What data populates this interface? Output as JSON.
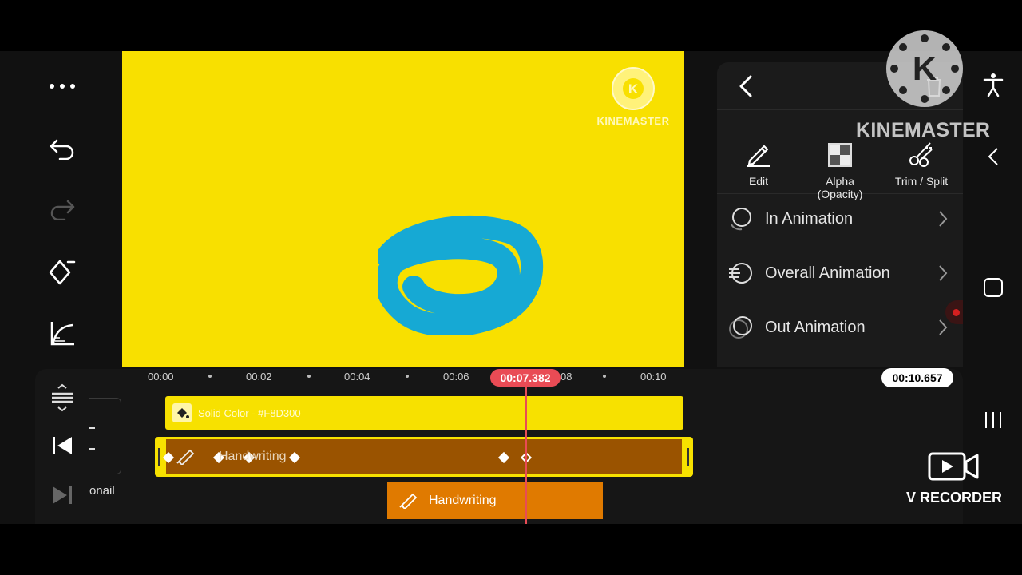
{
  "app": {
    "name": "KineMaster"
  },
  "watermark": {
    "brand": "KINEMASTER",
    "recorder": "V RECORDER"
  },
  "preview": {
    "background": "#F8E000",
    "logo_text": "KINEMASTER",
    "stroke_color": "#16A9D4"
  },
  "panel": {
    "tools": [
      {
        "label": "Edit",
        "icon": "pencil-icon"
      },
      {
        "label": "Alpha\n(Opacity)",
        "icon": "checker-icon"
      },
      {
        "label": "Trim / Split",
        "icon": "scissors-icon"
      }
    ],
    "animations": [
      {
        "label": "In Animation",
        "icon": "in-animation-icon"
      },
      {
        "label": "Overall Animation",
        "icon": "overall-animation-icon"
      },
      {
        "label": "Out Animation",
        "icon": "out-animation-icon"
      }
    ]
  },
  "timeline": {
    "ticks": [
      "00:00",
      "00:02",
      "00:04",
      "00:06",
      "08",
      "00:10"
    ],
    "playhead_time": "00:07.382",
    "duration": "00:10.657",
    "tracks": {
      "solid": "Solid Color - #F8D300",
      "handwriting_layer": "Handwriting",
      "handwriting_clip": "Handwriting"
    },
    "thumbnail_label": "onail",
    "colors": {
      "playhead": "#E94B55",
      "solid": "#F7E100",
      "handwriting": "#9A5300",
      "clip": "#E07A00"
    }
  }
}
